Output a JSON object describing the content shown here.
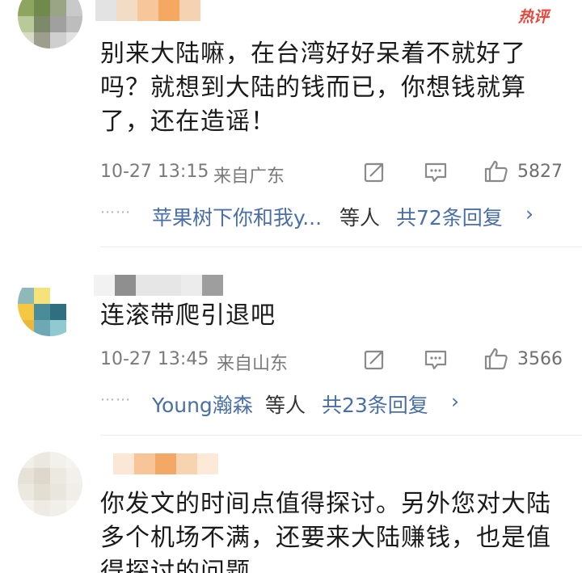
{
  "badge": {
    "hot_label": "热评"
  },
  "comments": [
    {
      "text_lines": [
        "别来大陆嘛，在台湾好好呆着不就好了",
        "吗？就想到大陆的钱而已，你想钱就算",
        "了，还在造谣！"
      ],
      "time": "10-27 13:15",
      "location": "来自广东",
      "likes": "5827",
      "reply_names": "苹果树下你和我y...",
      "reply_etc": "等人",
      "reply_total": "共72条回复",
      "reply_chevron": "›"
    },
    {
      "text_lines": [
        "连滚带爬引退吧"
      ],
      "time": "10-27 13:45",
      "location": "来自山东",
      "likes": "3566",
      "reply_names": "Young瀚森",
      "reply_etc": "等人",
      "reply_total": "共23条回复",
      "reply_chevron": "›"
    },
    {
      "text_lines": [
        "你发文的时间点值得探讨。另外您对大陆",
        "多个机场不满，还要来大陆赚钱，也是值",
        "得探讨的问题。"
      ]
    }
  ],
  "reply_dots": "⋯⋯",
  "icons": {
    "share": "share-icon",
    "comment": "comment-icon",
    "like": "thumbs-up-icon"
  },
  "colors": {
    "link": "#4a6fa5",
    "meta": "#7a7a7a",
    "hot": "#e5473d"
  }
}
